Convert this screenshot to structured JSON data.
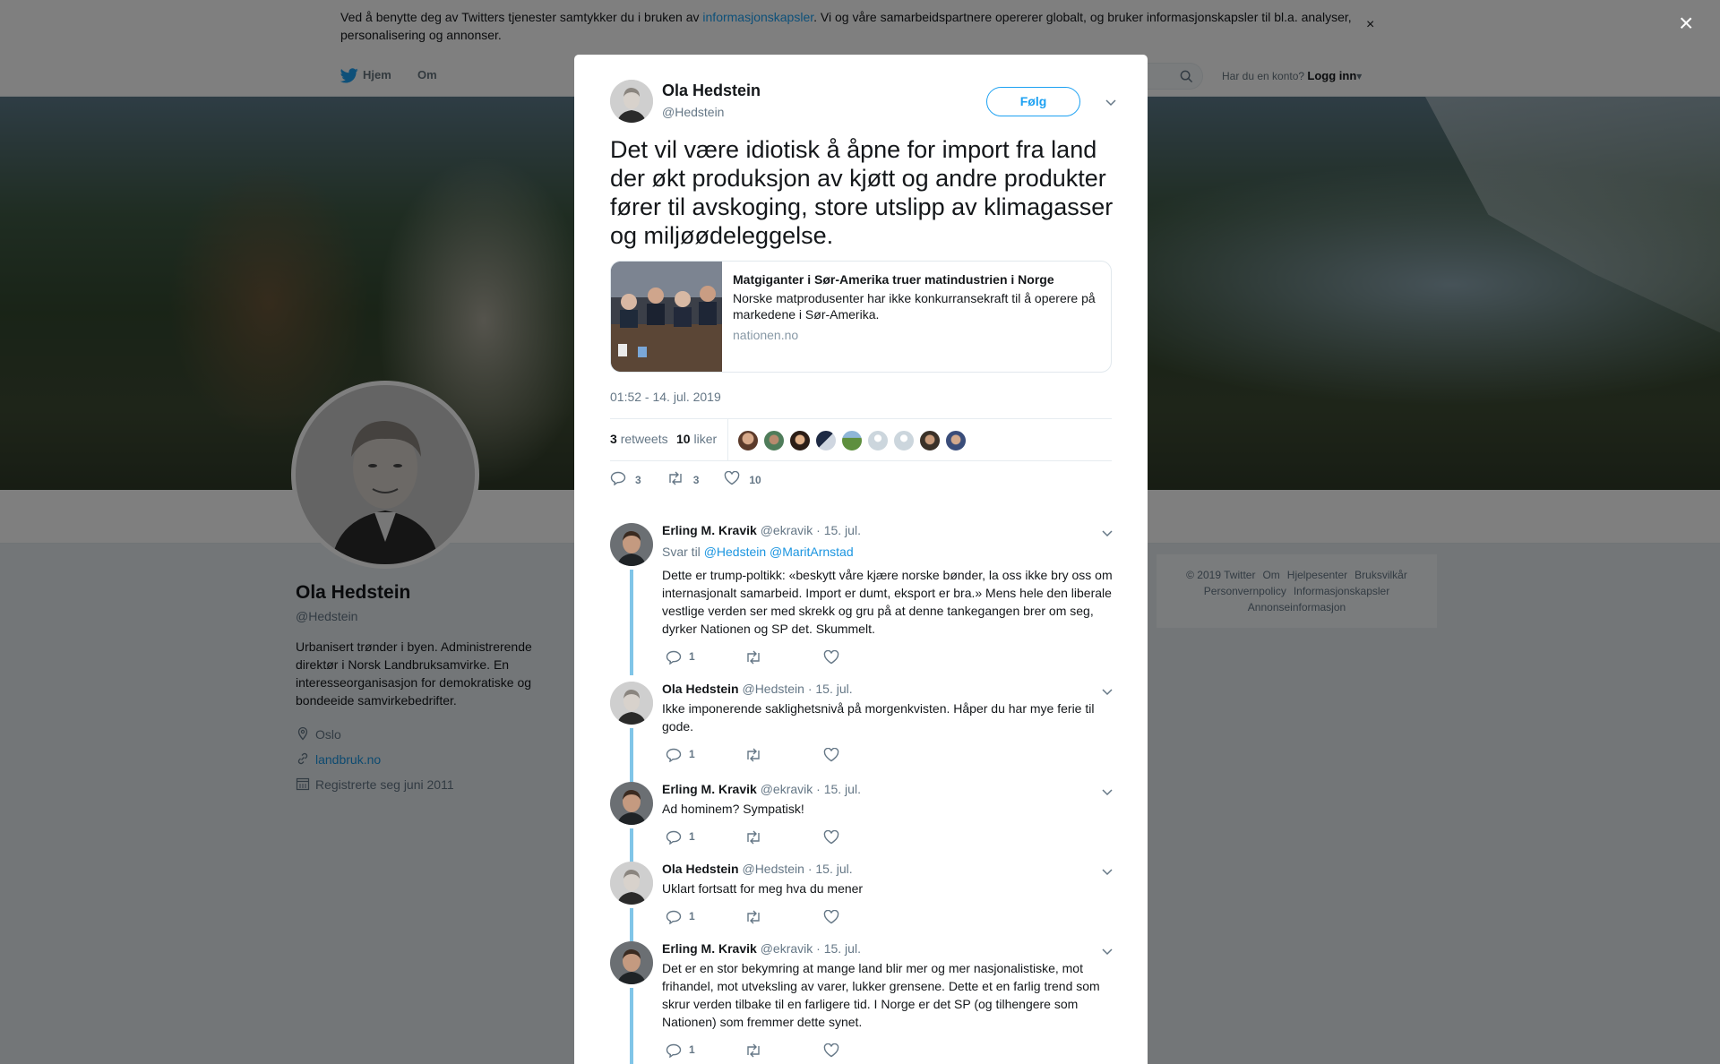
{
  "cookie_bar": {
    "text_before": "Ved å benytte deg av Twitters tjenester samtykker du i bruken av ",
    "link": "informasjonskapsler",
    "text_after": ". Vi og våre samarbeidspartnere opererer globalt, og bruker informasjonskapsler til bl.a. analyser, personalisering og annonser.",
    "close": "×"
  },
  "nav": {
    "home": "Hjem",
    "about": "Om",
    "login_prompt": "Har du en konto?",
    "login": "Logg inn"
  },
  "profile": {
    "name": "Ola Hedstein",
    "handle": "@Hedstein",
    "bio": "Urbanisert trønder i byen. Administrerende direktør i Norsk Landbruksamvirke. En interesseorganisasjon for demokratiske og bondeeide samvirkebedrifter.",
    "location": "Oslo",
    "website": "landbruk.no",
    "joined": "Registrerte seg juni 2011"
  },
  "footer": {
    "links": [
      "© 2019 Twitter",
      "Om",
      "Hjelpesenter",
      "Bruksvilkår",
      "Personvernpolicy",
      "Informasjonskapsler",
      "Annonseinformasjon"
    ]
  },
  "overlay_close": "×",
  "tweet": {
    "name": "Ola Hedstein",
    "handle": "@Hedstein",
    "follow": "Følg",
    "text": "Det vil være idiotisk å åpne for import fra land der økt produksjon av kjøtt og andre produkter fører til avskoging, store utslipp av klimagasser og miljøødeleggelse.",
    "card": {
      "title": "Matgiganter i Sør-Amerika truer matindustrien i Norge",
      "description": "Norske matprodusenter har ikke konkurransekraft til å operere på markedene i Sør-Amerika.",
      "domain": "nationen.no"
    },
    "timestamp": "01:52 - 14. jul. 2019",
    "retweets_count": "3",
    "retweets_label": "retweets",
    "likes_count": "10",
    "likes_label": "liker",
    "action_replies": "3",
    "action_retweets": "3",
    "action_likes": "10"
  },
  "replies": [
    {
      "name": "Erling M. Kravik",
      "handle": "@ekravik",
      "date": "· 15. jul.",
      "reply_to_label": "Svar til",
      "reply_to": "@Hedstein @MaritArnstad",
      "text": "Dette er trump-poltikk: «beskytt våre kjære norske bønder, la oss ikke bry oss om internasjonalt samarbeid. Import er dumt, eksport er bra.» Mens hele den liberale vestlige verden ser med skrekk og gru på at denne tankegangen brer om seg, dyrker Nationen og SP det. Skummelt.",
      "reply_count": "1"
    },
    {
      "name": "Ola Hedstein",
      "handle": "@Hedstein",
      "date": "· 15. jul.",
      "text": "Ikke imponerende saklighetsnivå på morgenkvisten. Håper du har mye ferie til gode.",
      "reply_count": "1"
    },
    {
      "name": "Erling M. Kravik",
      "handle": "@ekravik",
      "date": "· 15. jul.",
      "text": "Ad hominem? Sympatisk!",
      "reply_count": "1"
    },
    {
      "name": "Ola Hedstein",
      "handle": "@Hedstein",
      "date": "· 15. jul.",
      "text": "Uklart fortsatt for meg hva du mener",
      "reply_count": "1"
    },
    {
      "name": "Erling M. Kravik",
      "handle": "@ekravik",
      "date": "· 15. jul.",
      "text": "Det er en stor bekymring at mange land blir mer og mer nasjonalistiske, mot frihandel, mot utveksling av varer, lukker grensene. Dette et en farlig trend som skrur verden tilbake til en farligere tid. I Norge er det SP (og tilhengere som Nationen) som fremmer dette synet.",
      "reply_count": "1"
    }
  ],
  "colors": {
    "accent": "#1da1f2",
    "link": "#1b95e0",
    "muted": "#657786",
    "thread": "#80c5e8"
  }
}
